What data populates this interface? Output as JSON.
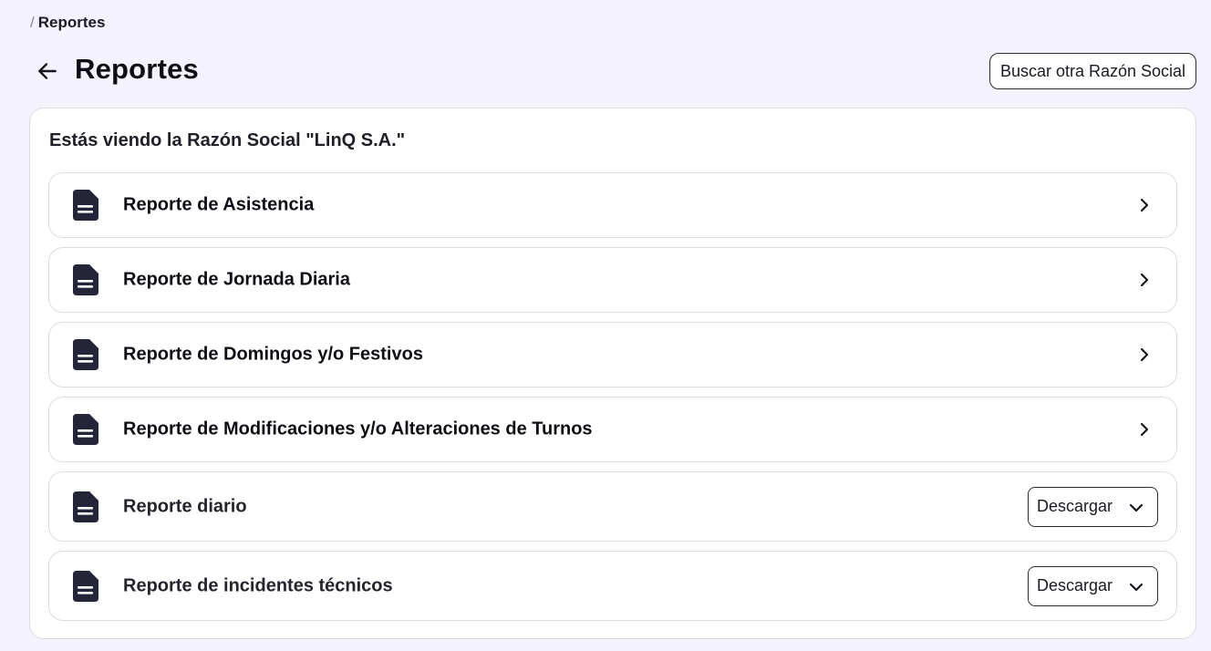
{
  "breadcrumb": {
    "separator": "/",
    "current": "Reportes"
  },
  "header": {
    "title": "Reportes",
    "back_icon": "arrow-left-icon",
    "search_button": "Buscar otra Razón Social"
  },
  "card": {
    "viewing_text": "Estás viendo la Razón Social \"LinQ S.A.\"",
    "reports": [
      {
        "label": "Reporte de Asistencia",
        "icon": "document-icon",
        "action": "chevron-right-icon"
      },
      {
        "label": "Reporte de Jornada Diaria",
        "icon": "document-icon",
        "action": "chevron-right-icon"
      },
      {
        "label": "Reporte de Domingos y/o Festivos",
        "icon": "document-icon",
        "action": "chevron-right-icon"
      },
      {
        "label": "Reporte de Modificaciones y/o Alteraciones de Turnos",
        "icon": "document-icon",
        "action": "chevron-right-icon"
      },
      {
        "label": "Reporte diario",
        "icon": "document-icon",
        "download": "Descargar"
      },
      {
        "label": "Reporte de incidentes técnicos",
        "icon": "document-icon",
        "download": "Descargar"
      }
    ]
  },
  "colors": {
    "background": "#f3f2fd",
    "card": "#ffffff",
    "border": "#dcdce4",
    "icon": "#25253a",
    "text": "#0e0e14"
  }
}
